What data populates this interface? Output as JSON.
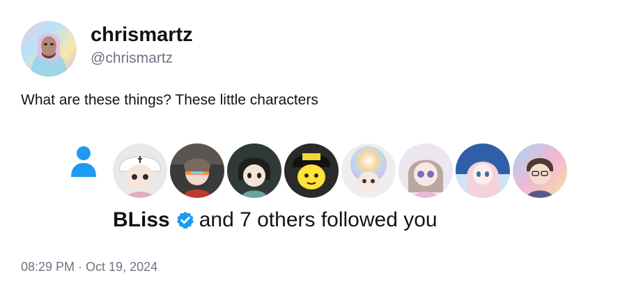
{
  "author": {
    "display_name": "chrismartz",
    "handle": "@chrismartz"
  },
  "tweet": {
    "text": "What are these things? These little characters",
    "timestamp": "08:29 PM · Oct 19, 2024"
  },
  "embedded_notification": {
    "icon": "person-icon",
    "follower_name": "BLiss",
    "verified_icon": "verified-badge-icon",
    "message": "and 7 others followed you",
    "follower_avatars": [
      {
        "name": "follower-avatar-1"
      },
      {
        "name": "follower-avatar-2"
      },
      {
        "name": "follower-avatar-3"
      },
      {
        "name": "follower-avatar-4"
      },
      {
        "name": "follower-avatar-5"
      },
      {
        "name": "follower-avatar-6"
      },
      {
        "name": "follower-avatar-7"
      },
      {
        "name": "follower-avatar-8"
      }
    ]
  },
  "colors": {
    "text_primary": "#0f1419",
    "text_secondary": "#6b7480",
    "accent_blue": "#1d9bf0"
  }
}
